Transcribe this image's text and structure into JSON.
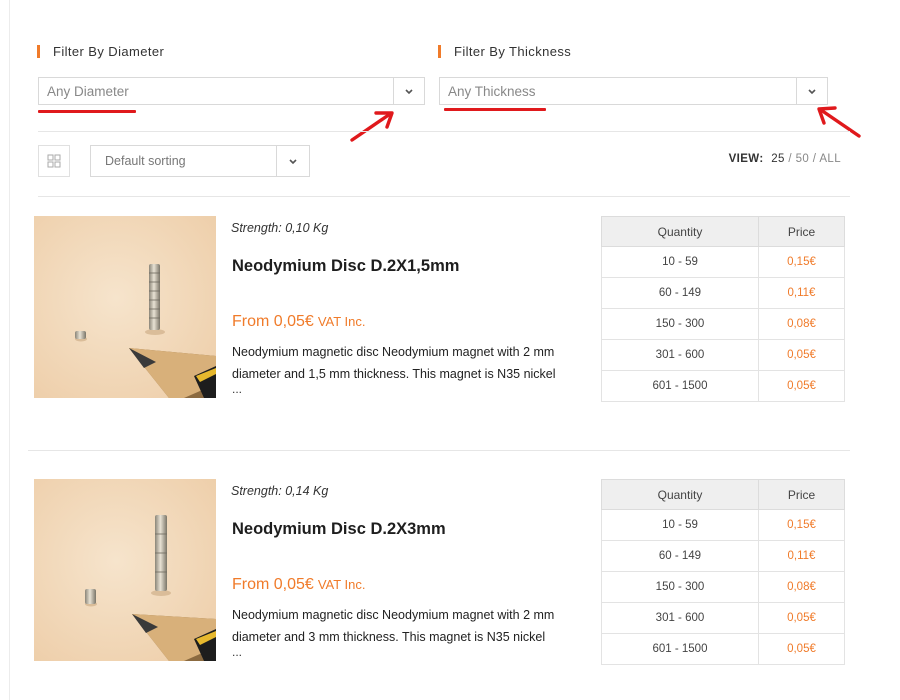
{
  "filters": {
    "diameter": {
      "heading": "Filter By Diameter",
      "value": "Any Diameter"
    },
    "thickness": {
      "heading": "Filter By Thickness",
      "value": "Any Thickness"
    }
  },
  "toolbar": {
    "sorting": "Default sorting",
    "view_label": "VIEW:",
    "view_options": [
      "25",
      "50",
      "ALL"
    ],
    "view_separator": " / "
  },
  "colors": {
    "accent": "#f07b2a",
    "annotation_red": "#e0191c"
  },
  "table_headers": {
    "quantity": "Quantity",
    "price": "Price"
  },
  "products": [
    {
      "strength": "Strength: 0,10 Kg",
      "title": "Neodymium Disc D.2X1,5mm",
      "price": "From 0,05€",
      "vat": "VAT Inc.",
      "description": "Neodymium magnetic disc Neodymium magnet with 2 mm diameter and 1,5 mm thickness. This magnet is N35 nickel",
      "ellipsis": "...",
      "tiers": [
        {
          "qty": "10 - 59",
          "price": "0,15€"
        },
        {
          "qty": "60 - 149",
          "price": "0,11€"
        },
        {
          "qty": "150 - 300",
          "price": "0,08€"
        },
        {
          "qty": "301 - 600",
          "price": "0,05€"
        },
        {
          "qty": "601 - 1500",
          "price": "0,05€"
        }
      ]
    },
    {
      "strength": "Strength: 0,14 Kg",
      "title": "Neodymium Disc D.2X3mm",
      "price": "From 0,05€",
      "vat": "VAT Inc.",
      "description": "Neodymium magnetic disc Neodymium magnet with 2 mm diameter and 3 mm thickness. This magnet is N35 nickel",
      "ellipsis": "...",
      "tiers": [
        {
          "qty": "10 - 59",
          "price": "0,15€"
        },
        {
          "qty": "60 - 149",
          "price": "0,11€"
        },
        {
          "qty": "150 - 300",
          "price": "0,08€"
        },
        {
          "qty": "301 - 600",
          "price": "0,05€"
        },
        {
          "qty": "601 - 1500",
          "price": "0,05€"
        }
      ]
    }
  ]
}
